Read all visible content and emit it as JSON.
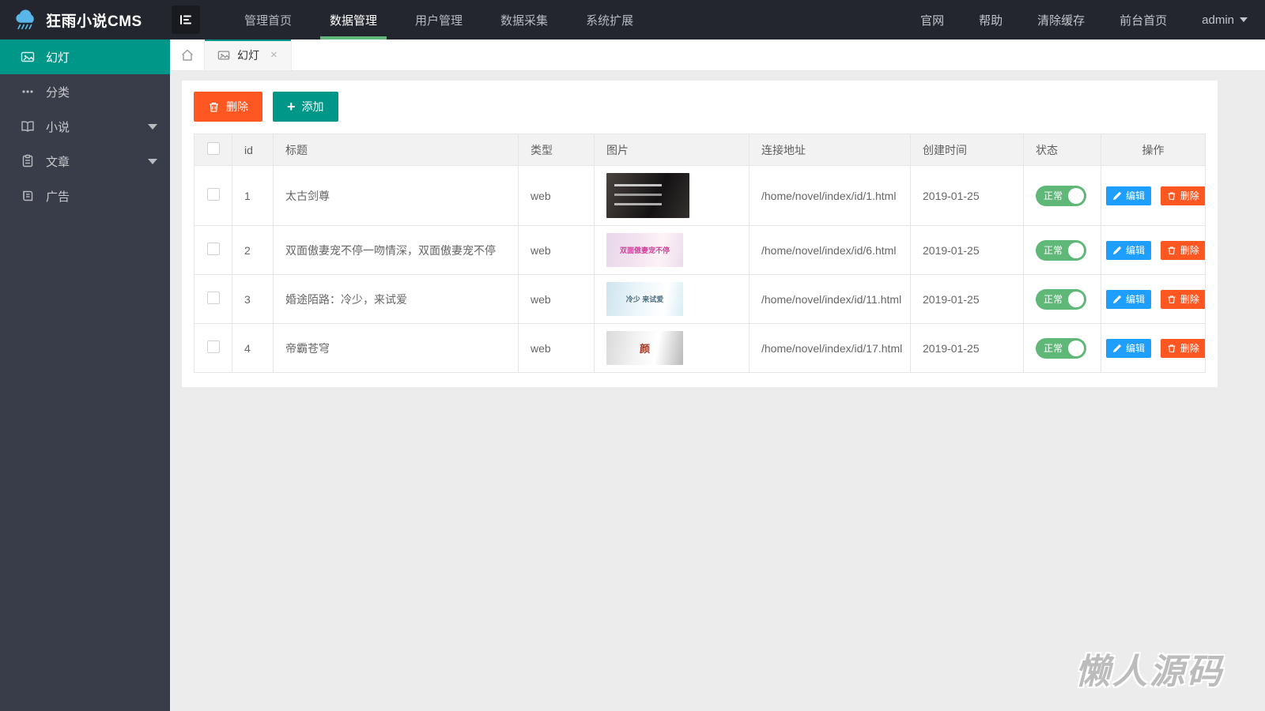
{
  "app": {
    "title": "狂雨小说CMS"
  },
  "colors": {
    "header_bg": "#23262e",
    "sidebar_bg": "#393d49",
    "accent_teal": "#009688",
    "accent_green": "#5FB878",
    "danger": "#FF5722",
    "edit_blue": "#1E9FFF",
    "content_bg": "#ececec"
  },
  "topnav": {
    "items": [
      {
        "label": "管理首页",
        "active": false
      },
      {
        "label": "数据管理",
        "active": true
      },
      {
        "label": "用户管理",
        "active": false
      },
      {
        "label": "数据采集",
        "active": false
      },
      {
        "label": "系统扩展",
        "active": false
      }
    ],
    "right_items": [
      {
        "label": "官网"
      },
      {
        "label": "帮助"
      },
      {
        "label": "清除缓存"
      },
      {
        "label": "前台首页"
      },
      {
        "label": "admin",
        "has_dropdown": true
      }
    ]
  },
  "sidebar": {
    "items": [
      {
        "label": "幻灯",
        "icon": "slideshow-icon",
        "active": true,
        "has_submenu": false
      },
      {
        "label": "分类",
        "icon": "ellipsis-icon",
        "active": false,
        "has_submenu": false
      },
      {
        "label": "小说",
        "icon": "book-icon",
        "active": false,
        "has_submenu": true
      },
      {
        "label": "文章",
        "icon": "article-icon",
        "active": false,
        "has_submenu": true
      },
      {
        "label": "广告",
        "icon": "ad-icon",
        "active": false,
        "has_submenu": false
      }
    ]
  },
  "tabbar": {
    "active_tab": {
      "label": "幻灯",
      "icon": "image-icon",
      "close": "×"
    }
  },
  "toolbar": {
    "delete_label": "删除",
    "add_label": "添加",
    "add_plus": "+"
  },
  "table": {
    "headers": {
      "id": "id",
      "title": "标题",
      "type": "类型",
      "image": "图片",
      "url": "连接地址",
      "created": "创建时间",
      "status": "状态",
      "ops": "操作"
    },
    "edit_label": "编辑",
    "delete_label": "删除",
    "status_on_label": "正常",
    "rows": [
      {
        "id": "1",
        "title": "太古剑尊",
        "type": "web",
        "thumb": {
          "variant": "dark",
          "text": ""
        },
        "url": "/home/novel/index/id/1.html",
        "created": "2019-01-25",
        "status": "正常"
      },
      {
        "id": "2",
        "title": "双面傲妻宠不停一吻情深，双面傲妻宠不停",
        "type": "web",
        "thumb": {
          "variant": "pink",
          "text": "双面傲妻宠不停"
        },
        "url": "/home/novel/index/id/6.html",
        "created": "2019-01-25",
        "status": "正常"
      },
      {
        "id": "3",
        "title": "婚途陌路：冷少，来试爱",
        "type": "web",
        "thumb": {
          "variant": "blue",
          "text": "冷少 来试爱"
        },
        "url": "/home/novel/index/id/11.html",
        "created": "2019-01-25",
        "status": "正常"
      },
      {
        "id": "4",
        "title": "帝霸苍穹",
        "type": "web",
        "thumb": {
          "variant": "ink",
          "text": "颜"
        },
        "url": "/home/novel/index/id/17.html",
        "created": "2019-01-25",
        "status": "正常"
      }
    ]
  },
  "watermark": "懒人源码"
}
